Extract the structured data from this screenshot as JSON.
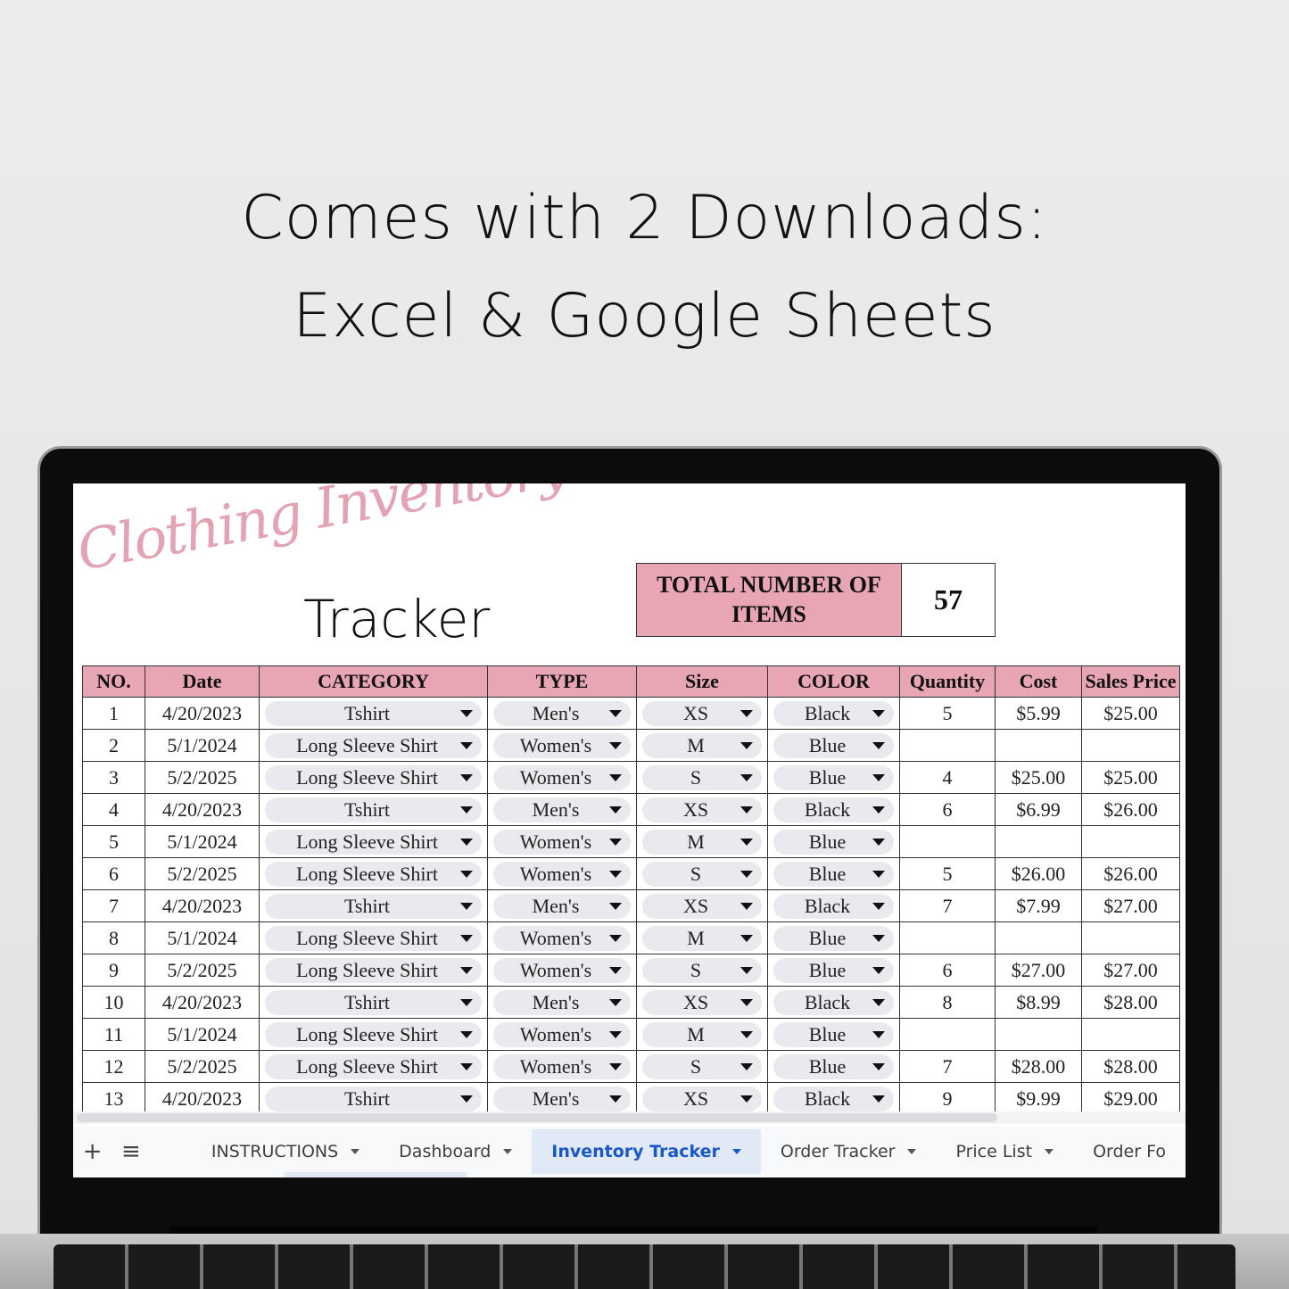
{
  "headline": {
    "line1": "Comes with 2 Downloads:",
    "line2": "Excel & Google Sheets"
  },
  "sheet": {
    "title_script": "Clothing Inventory",
    "title_main": "Tracker",
    "total": {
      "label": "TOTAL NUMBER OF ITEMS",
      "value": "57"
    },
    "columns": [
      "NO.",
      "Date",
      "CATEGORY",
      "TYPE",
      "Size",
      "COLOR",
      "Quantity",
      "Cost",
      "Sales Price"
    ],
    "rows": [
      {
        "no": "1",
        "date": "4/20/2023",
        "category": "Tshirt",
        "type": "Men's",
        "size": "XS",
        "color": "Black",
        "quantity": "5",
        "cost": "$5.99",
        "sales_price": "$25.00"
      },
      {
        "no": "2",
        "date": "5/1/2024",
        "category": "Long Sleeve Shirt",
        "type": "Women's",
        "size": "M",
        "color": "Blue",
        "quantity": "",
        "cost": "",
        "sales_price": ""
      },
      {
        "no": "3",
        "date": "5/2/2025",
        "category": "Long Sleeve Shirt",
        "type": "Women's",
        "size": "S",
        "color": "Blue",
        "quantity": "4",
        "cost": "$25.00",
        "sales_price": "$25.00"
      },
      {
        "no": "4",
        "date": "4/20/2023",
        "category": "Tshirt",
        "type": "Men's",
        "size": "XS",
        "color": "Black",
        "quantity": "6",
        "cost": "$6.99",
        "sales_price": "$26.00"
      },
      {
        "no": "5",
        "date": "5/1/2024",
        "category": "Long Sleeve Shirt",
        "type": "Women's",
        "size": "M",
        "color": "Blue",
        "quantity": "",
        "cost": "",
        "sales_price": ""
      },
      {
        "no": "6",
        "date": "5/2/2025",
        "category": "Long Sleeve Shirt",
        "type": "Women's",
        "size": "S",
        "color": "Blue",
        "quantity": "5",
        "cost": "$26.00",
        "sales_price": "$26.00"
      },
      {
        "no": "7",
        "date": "4/20/2023",
        "category": "Tshirt",
        "type": "Men's",
        "size": "XS",
        "color": "Black",
        "quantity": "7",
        "cost": "$7.99",
        "sales_price": "$27.00"
      },
      {
        "no": "8",
        "date": "5/1/2024",
        "category": "Long Sleeve Shirt",
        "type": "Women's",
        "size": "M",
        "color": "Blue",
        "quantity": "",
        "cost": "",
        "sales_price": ""
      },
      {
        "no": "9",
        "date": "5/2/2025",
        "category": "Long Sleeve Shirt",
        "type": "Women's",
        "size": "S",
        "color": "Blue",
        "quantity": "6",
        "cost": "$27.00",
        "sales_price": "$27.00"
      },
      {
        "no": "10",
        "date": "4/20/2023",
        "category": "Tshirt",
        "type": "Men's",
        "size": "XS",
        "color": "Black",
        "quantity": "8",
        "cost": "$8.99",
        "sales_price": "$28.00"
      },
      {
        "no": "11",
        "date": "5/1/2024",
        "category": "Long Sleeve Shirt",
        "type": "Women's",
        "size": "M",
        "color": "Blue",
        "quantity": "",
        "cost": "",
        "sales_price": ""
      },
      {
        "no": "12",
        "date": "5/2/2025",
        "category": "Long Sleeve Shirt",
        "type": "Women's",
        "size": "S",
        "color": "Blue",
        "quantity": "7",
        "cost": "$28.00",
        "sales_price": "$28.00"
      },
      {
        "no": "13",
        "date": "4/20/2023",
        "category": "Tshirt",
        "type": "Men's",
        "size": "XS",
        "color": "Black",
        "quantity": "9",
        "cost": "$9.99",
        "sales_price": "$29.00"
      }
    ]
  },
  "tabbar": {
    "add_icon": "+",
    "menu_icon": "≡",
    "tabs": [
      {
        "label": "INSTRUCTIONS",
        "active": false
      },
      {
        "label": "Dashboard",
        "active": false
      },
      {
        "label": "Inventory Tracker",
        "active": true
      },
      {
        "label": "Order Tracker",
        "active": false
      },
      {
        "label": "Price List",
        "active": false
      },
      {
        "label": "Order Fo",
        "active": false
      }
    ]
  },
  "colors": {
    "header_pink": "#e8a6b4",
    "script_pink": "#e3a3b3",
    "active_tab_blue": "#1a57c9",
    "chip_gray": "#e8eaed"
  }
}
